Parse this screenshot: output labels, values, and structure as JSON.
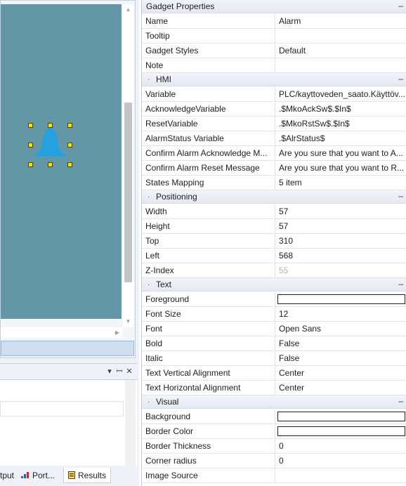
{
  "bottom_panel": {
    "tabs": [
      {
        "label": "tput"
      },
      {
        "label": "Port..."
      },
      {
        "label": "Results"
      }
    ]
  },
  "properties": {
    "header": "Gadget Properties",
    "general": [
      {
        "name": "Name",
        "value": "Alarm"
      },
      {
        "name": "Tooltip",
        "value": ""
      },
      {
        "name": "Gadget Styles",
        "value": "Default"
      },
      {
        "name": "Note",
        "value": ""
      }
    ],
    "hmi": {
      "title": "HMI",
      "rows": [
        {
          "name": "Variable",
          "value": "PLC/kayttoveden_saato.Käyttöv..."
        },
        {
          "name": "AcknowledgeVariable",
          "value": ".$MkoAckSw$.$In$"
        },
        {
          "name": "ResetVariable",
          "value": ".$MkoRstSw$.$In$"
        },
        {
          "name": "AlarmStatus Variable",
          "value": ".$AlrStatus$"
        },
        {
          "name": "Confirm Alarm Acknowledge M...",
          "value": "Are you sure that you want to A..."
        },
        {
          "name": "Confirm Alarm Reset Message",
          "value": "Are you sure that you want to R..."
        },
        {
          "name": "States Mapping",
          "value": "5 item"
        }
      ]
    },
    "positioning": {
      "title": "Positioning",
      "rows": [
        {
          "name": "Width",
          "value": "57"
        },
        {
          "name": "Height",
          "value": "57"
        },
        {
          "name": "Top",
          "value": "310"
        },
        {
          "name": "Left",
          "value": "568"
        },
        {
          "name": "Z-Index",
          "value": "55"
        }
      ]
    },
    "text": {
      "title": "Text",
      "rows": [
        {
          "name": "Foreground",
          "value": ""
        },
        {
          "name": "Font Size",
          "value": "12"
        },
        {
          "name": "Font",
          "value": "Open Sans"
        },
        {
          "name": "Bold",
          "value": "False"
        },
        {
          "name": "Italic",
          "value": "False"
        },
        {
          "name": "Text Vertical Alignment",
          "value": "Center"
        },
        {
          "name": "Text Horizontal Alignment",
          "value": "Center"
        }
      ]
    },
    "visual": {
      "title": "Visual",
      "rows": [
        {
          "name": "Background",
          "value": ""
        },
        {
          "name": "Border Color",
          "value": ""
        },
        {
          "name": "Border Thickness",
          "value": "0"
        },
        {
          "name": "Corner radius",
          "value": "0"
        },
        {
          "name": "Image Source",
          "value": ""
        }
      ]
    },
    "collapse_glyph": "–",
    "bullet_glyph": "·"
  },
  "icons": {
    "gadget": "bell-icon",
    "selection": "resize-handle",
    "results_tab": "results-icon",
    "ports_tab": "ports-icon"
  },
  "colors": {
    "canvas": "#6497a5",
    "bell": "#27a0e0",
    "handle": "#ffde00",
    "category": "#e9edf3",
    "foreground_swatch": "#ffffff",
    "background_swatch": "#ffffff",
    "border_swatch": "#ffffff"
  }
}
